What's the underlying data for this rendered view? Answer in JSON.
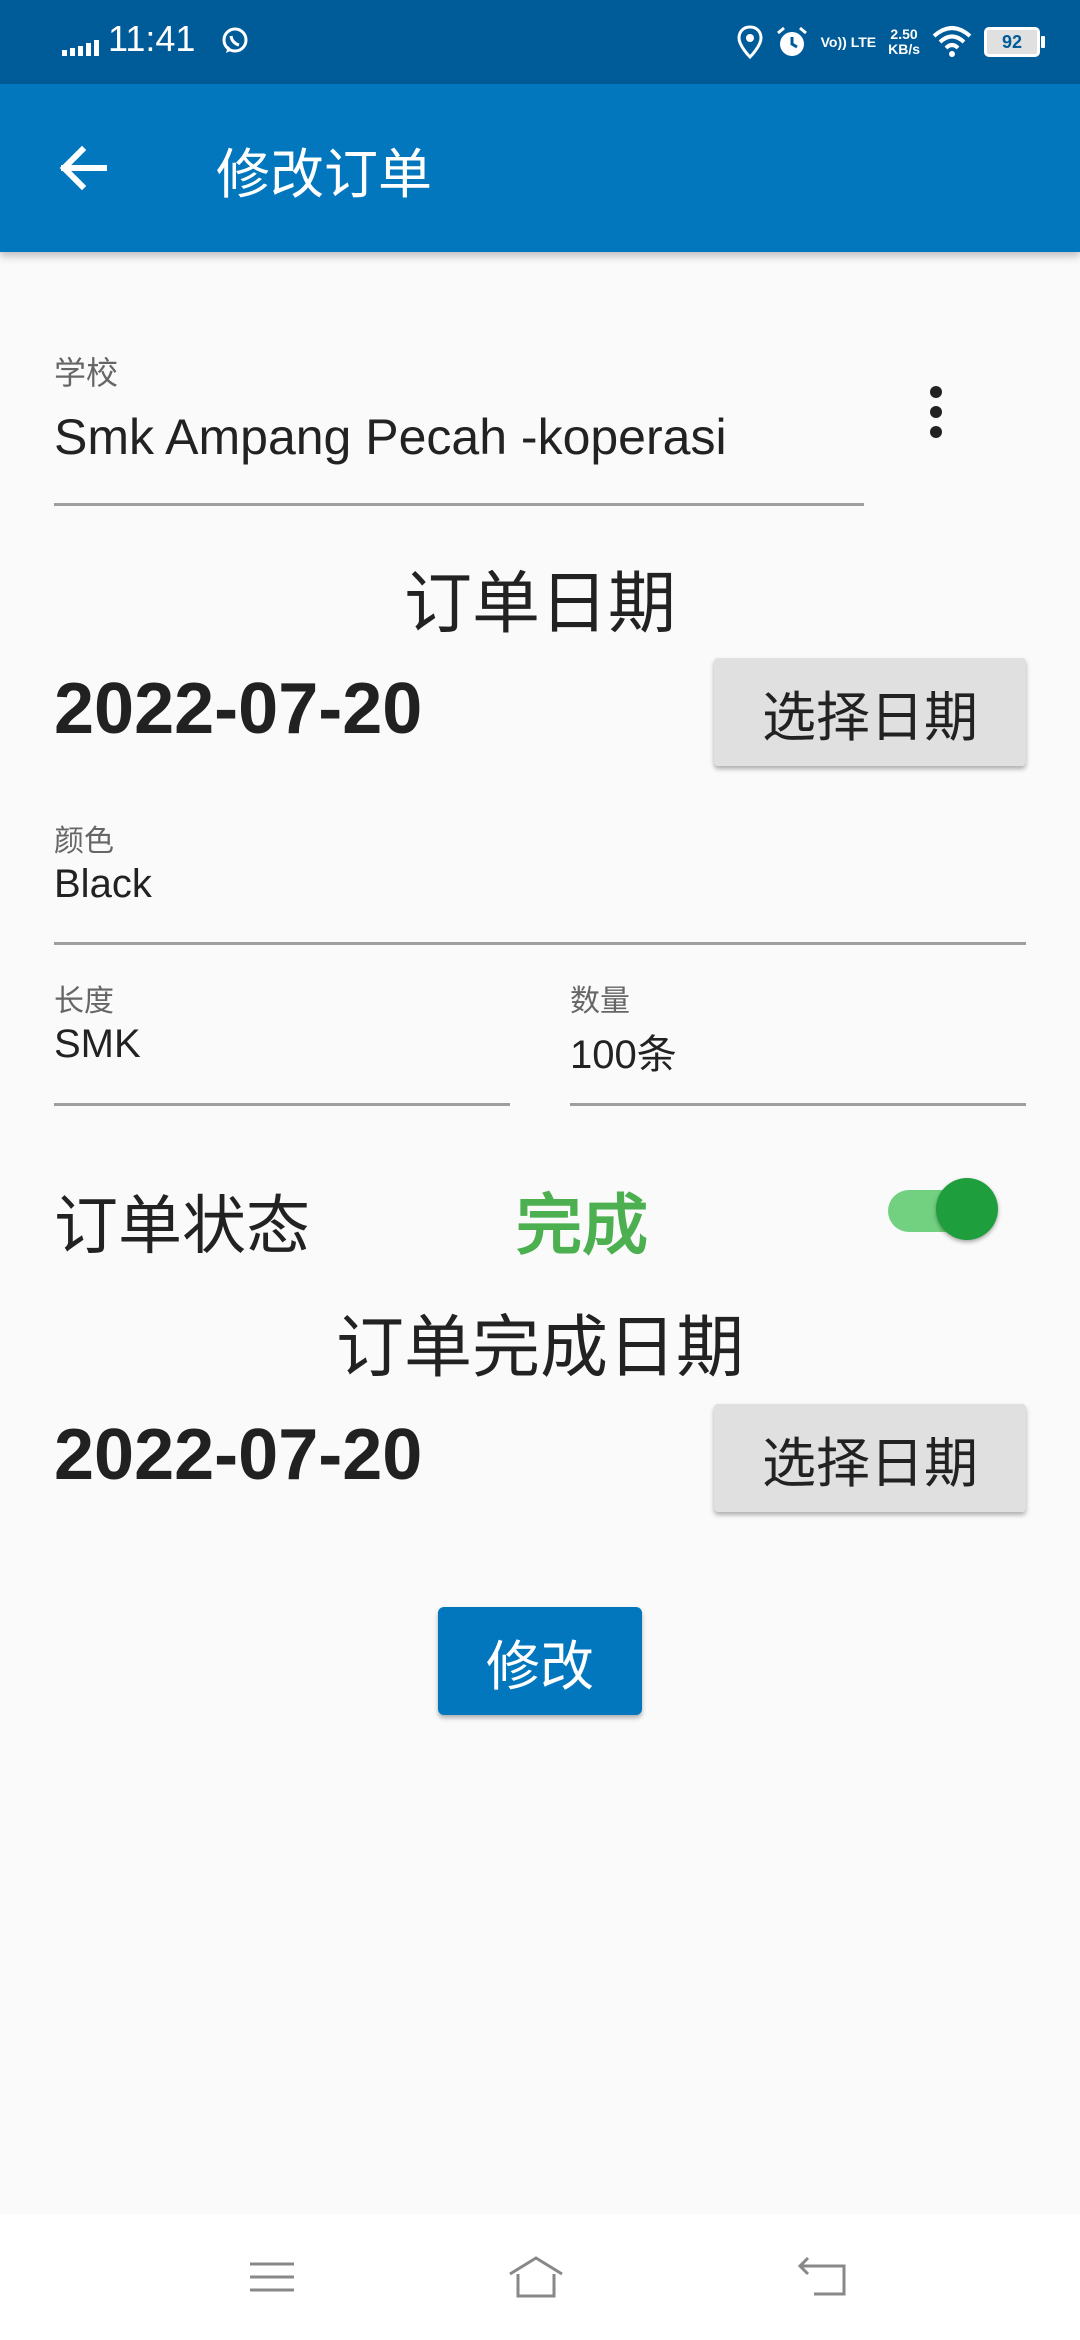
{
  "status_bar": {
    "time": "11:41",
    "network_speed": "2.50",
    "network_speed_unit": "KB/s",
    "volte_label": "Vo)) LTE",
    "battery": "92",
    "icons": [
      "signal-icon",
      "whatsapp-icon",
      "location-icon",
      "alarm-icon",
      "wifi-icon",
      "battery-icon"
    ]
  },
  "app_bar": {
    "title": "修改订单",
    "back_icon": "arrow-back-icon",
    "color": "#0277bd"
  },
  "form": {
    "school": {
      "label": "学校",
      "value": "Smk Ampang Pecah -koperasi"
    },
    "order_date": {
      "title": "订单日期",
      "value": "2022-07-20",
      "button": "选择日期"
    },
    "color": {
      "label": "颜色",
      "value": "Black"
    },
    "length": {
      "label": "长度",
      "value": "SMK"
    },
    "quantity": {
      "label": "数量",
      "value": "100条"
    },
    "order_status": {
      "label": "订单状态",
      "value": "完成",
      "enabled": true,
      "value_color": "#4caf50"
    },
    "completion_date": {
      "title": "订单完成日期",
      "value": "2022-07-20",
      "button": "选择日期"
    },
    "submit_label": "修改"
  },
  "nav_bar": {
    "icons": [
      "menu-icon",
      "home-icon",
      "back-nav-icon"
    ]
  }
}
